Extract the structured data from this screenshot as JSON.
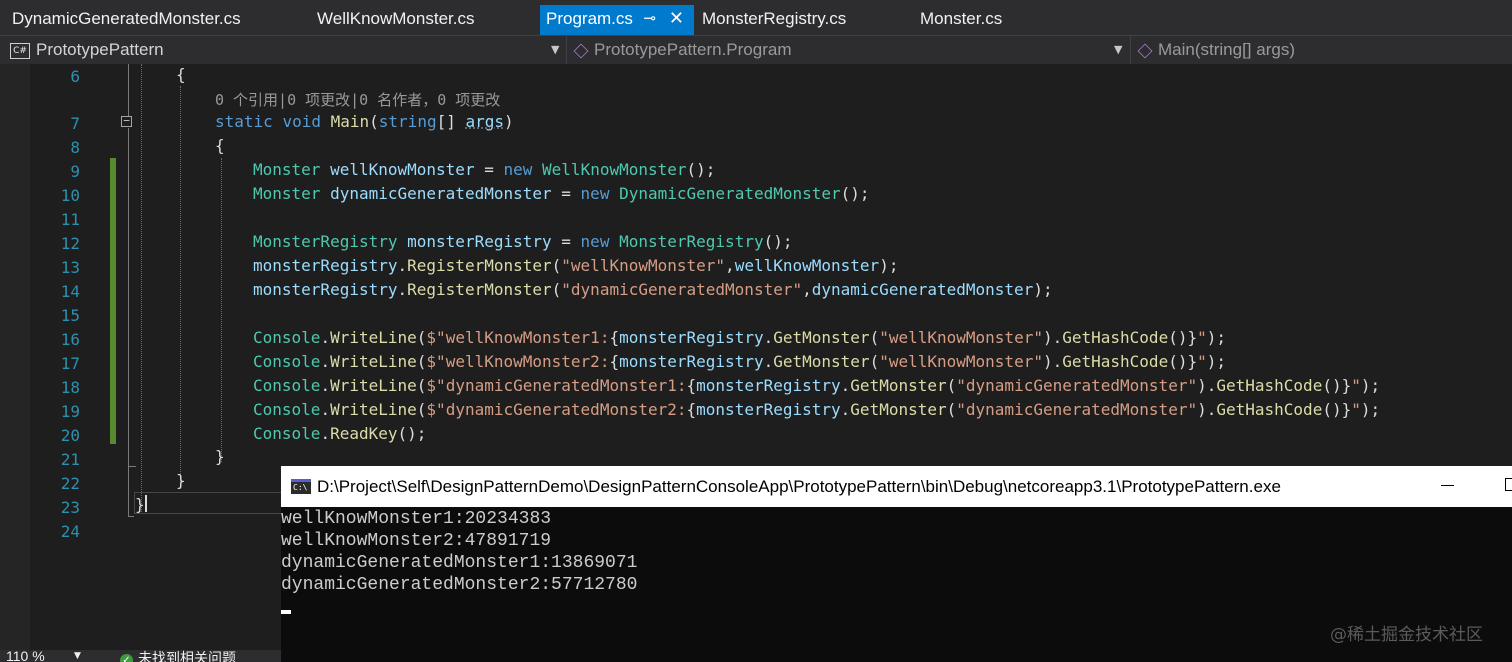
{
  "tabs": [
    {
      "label": "DynamicGeneratedMonster.cs"
    },
    {
      "label": "WellKnowMonster.cs"
    },
    {
      "label": "Program.cs",
      "pin": "⊸",
      "close": "✕"
    },
    {
      "label": "MonsterRegistry.cs"
    },
    {
      "label": "Monster.cs"
    }
  ],
  "navbar": {
    "project": "PrototypePattern",
    "project_badge": "C#",
    "class": "PrototypePattern.Program",
    "member": "Main(string[] args)"
  },
  "editor": {
    "line_numbers": [
      "6",
      "7",
      "8",
      "9",
      "10",
      "11",
      "12",
      "13",
      "14",
      "15",
      "16",
      "17",
      "18",
      "19",
      "20",
      "21",
      "22",
      "23",
      "24"
    ],
    "codelens": "0 个引用|0 项更改|0 名作者，0 项更改",
    "fold_marker": "−",
    "lines": {
      "l6": {
        "brace": "{"
      },
      "l7": {
        "static": "static",
        "void": "void",
        "main": "Main",
        "open": "(",
        "string": "string",
        "brackets": "[] ",
        "args": "args",
        "close": ")"
      },
      "l8": {
        "brace": "{"
      },
      "l9": {
        "type": "Monster",
        "var": "wellKnowMonster",
        "eq": " = ",
        "new": "new",
        "ctor": "WellKnowMonster",
        "end": "();"
      },
      "l10": {
        "type": "Monster",
        "var": "dynamicGeneratedMonster",
        "eq": " = ",
        "new": "new",
        "ctor": "DynamicGeneratedMonster",
        "end": "();"
      },
      "l12": {
        "type": "MonsterRegistry",
        "var": "monsterRegistry",
        "eq": " = ",
        "new": "new",
        "ctor": "MonsterRegistry",
        "end": "();"
      },
      "l13": {
        "obj": "monsterRegistry",
        "dot": ".",
        "method": "RegisterMonster",
        "open": "(",
        "str": "\"wellKnowMonster\"",
        "comma": ",",
        "arg": "wellKnowMonster",
        "end": ");"
      },
      "l14": {
        "obj": "monsterRegistry",
        "dot": ".",
        "method": "RegisterMonster",
        "open": "(",
        "str": "\"dynamicGeneratedMonster\"",
        "comma": ",",
        "arg": "dynamicGeneratedMonster",
        "end": ");"
      },
      "l16": {
        "cls": "Console",
        "dot": ".",
        "method": "WriteLine",
        "open": "(",
        "s1": "$\"wellKnowMonster1:",
        "lb": "{",
        "obj": "monsterRegistry",
        "dot2": ".",
        "m2": "GetMonster",
        "open2": "(",
        "key": "\"wellKnowMonster\"",
        "close2": ").",
        "m3": "GetHashCode",
        "paren3": "()",
        "rb": "}",
        "s2": "\"",
        "end": ");"
      },
      "l17": {
        "cls": "Console",
        "dot": ".",
        "method": "WriteLine",
        "open": "(",
        "s1": "$\"wellKnowMonster2:",
        "lb": "{",
        "obj": "monsterRegistry",
        "dot2": ".",
        "m2": "GetMonster",
        "open2": "(",
        "key": "\"wellKnowMonster\"",
        "close2": ").",
        "m3": "GetHashCode",
        "paren3": "()",
        "rb": "}",
        "s2": "\"",
        "end": ");"
      },
      "l18": {
        "cls": "Console",
        "dot": ".",
        "method": "WriteLine",
        "open": "(",
        "s1": "$\"dynamicGeneratedMonster1:",
        "lb": "{",
        "obj": "monsterRegistry",
        "dot2": ".",
        "m2": "GetMonster",
        "open2": "(",
        "key": "\"dynamicGeneratedMonster\"",
        "close2": ").",
        "m3": "GetHashCode",
        "paren3": "()",
        "rb": "}",
        "s2": "\"",
        "end": ");"
      },
      "l19": {
        "cls": "Console",
        "dot": ".",
        "method": "WriteLine",
        "open": "(",
        "s1": "$\"dynamicGeneratedMonster2:",
        "lb": "{",
        "obj": "monsterRegistry",
        "dot2": ".",
        "m2": "GetMonster",
        "open2": "(",
        "key": "\"dynamicGeneratedMonster\"",
        "close2": ").",
        "m3": "GetHashCode",
        "paren3": "()",
        "rb": "}",
        "s2": "\"",
        "end": ");"
      },
      "l20": {
        "cls": "Console",
        "dot": ".",
        "method": "ReadKey",
        "end": "();"
      },
      "l21": {
        "brace": "}"
      },
      "l22": {
        "brace": "}"
      },
      "l23": {
        "brace": "}"
      }
    }
  },
  "status": {
    "zoom": "110 %",
    "issues": "未找到相关问题"
  },
  "console": {
    "title": "D:\\Project\\Self\\DesignPatternDemo\\DesignPatternConsoleApp\\PrototypePattern\\bin\\Debug\\netcoreapp3.1\\PrototypePattern.exe",
    "icon_text": "C:\\",
    "lines": [
      "wellKnowMonster1:20234383",
      "wellKnowMonster2:47891719",
      "dynamicGeneratedMonster1:13869071",
      "dynamicGeneratedMonster2:57712780"
    ]
  },
  "watermark": "@稀土掘金技术社区",
  "colors": {
    "editor_bg": "#1e1e1e",
    "keyword": "#569cd6",
    "type": "#4ec9b0",
    "method": "#dcdcaa",
    "identifier": "#9cdcfe",
    "string": "#d69d85",
    "line_number": "#2b91af",
    "active_tab": "#007acc",
    "change_bar": "#5a8a2e"
  }
}
